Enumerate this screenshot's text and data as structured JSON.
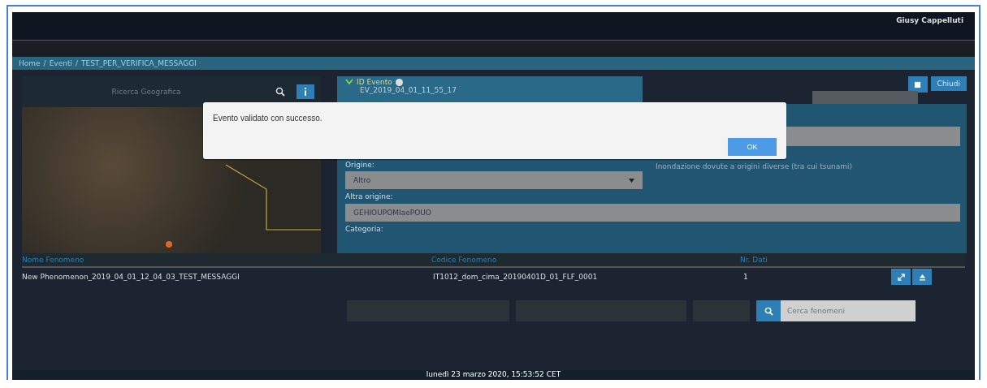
{
  "header": {
    "user_name": "Giusy Cappelluti"
  },
  "breadcrumb": {
    "separator": "/",
    "items": [
      "Home",
      "Eventi",
      "TEST_PER_VERIFICA_MESSAGGI"
    ]
  },
  "map_panel": {
    "search_placeholder": "Ricerca Geografica"
  },
  "event": {
    "id_label": "ID Evento",
    "id_value": "EV_2019_04_01_11_55_17",
    "close_button": "Chiudi"
  },
  "form": {
    "origin_label": "Origine:",
    "origin_value": "Altro",
    "category_description": "Inondazione dovute a origini diverse (tra cui tsunami)",
    "other_origin_label": "Altra origine:",
    "other_origin_value": "GEHIOUPOMIaePOUO",
    "category_label": "Categoria:"
  },
  "table": {
    "columns": [
      "Nome Fenomeno",
      "Codice Fenomeno",
      "Nr. Dati"
    ],
    "rows": [
      {
        "cells": [
          "New Phenomenon_2019_04_01_12_04_03_TEST_MESSAGGI",
          "IT1012_dom_cima_20190401D_01_FLF_0001",
          "1"
        ]
      }
    ]
  },
  "search": {
    "placeholder": "Cerca fenomeni"
  },
  "status_bar": {
    "datetime": "lunedì 23 marzo 2020, 15:53:52 CET"
  },
  "dialog": {
    "message": "Evento validato con successo.",
    "button": "OK"
  }
}
